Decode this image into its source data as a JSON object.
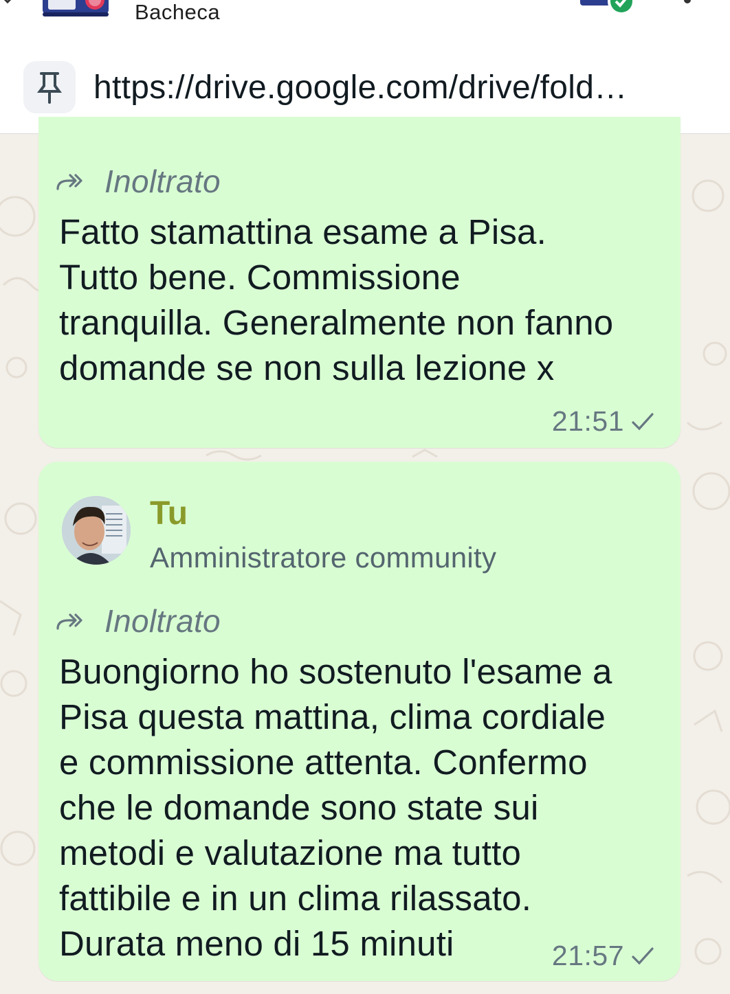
{
  "header": {
    "title": "Bacheca"
  },
  "pinned": {
    "url": "https://drive.google.com/drive/fold…"
  },
  "messages": [
    {
      "forwarded_label": "Inoltrato",
      "text": "Fatto stamattina esame a Pisa.\nTutto bene. Commissione\ntranquilla. Generalmente non fanno\ndomande se non sulla lezione x",
      "time": "21:51"
    },
    {
      "sender": {
        "name": "Tu",
        "role": "Amministratore community"
      },
      "forwarded_label": "Inoltrato",
      "text": "Buongiorno ho sostenuto l'esame a\nPisa questa mattina, clima cordiale\ne commissione attenta. Confermo\nche le domande sono state sui\nmetodi e valutazione ma tutto\nfattibile e in un clima rilassato.\nDurata meno di 15 minuti",
      "time": "21:57"
    }
  ],
  "colors": {
    "bubble": "#d9fdd3",
    "chat_background": "#f3efe9",
    "sender_name": "#8a9a2a",
    "meta": "#667781"
  },
  "icons": [
    "chevron-icon",
    "community-logo",
    "pin-icon",
    "forward-icon",
    "single-check-icon",
    "verified-badge-icon"
  ]
}
